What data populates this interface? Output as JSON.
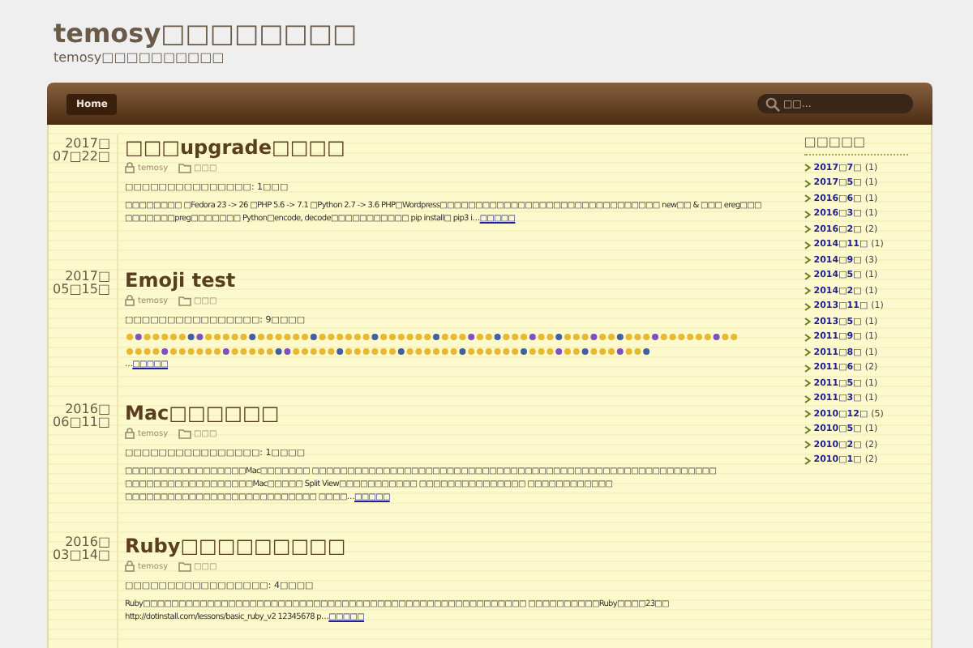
{
  "site": {
    "title": "temosy□□□□□□□□",
    "tagline": "temosy□□□□□□□□□□"
  },
  "nav": {
    "items": [
      {
        "label": "Home",
        "selected": true
      }
    ],
    "search": {
      "placeholder": "□□…"
    }
  },
  "posts": [
    {
      "date_year": "2017□",
      "date_day": "07□22□",
      "title": "□□□upgrade□□□□",
      "author": "temosy",
      "category": "□□□",
      "summary": "□□□□□□□□□□□□□□□: 1□□□",
      "kind": "text",
      "excerpt": "□□□□□□□□ □Fedora 23 -> 26 □PHP 5.6 -> 7.1 □Python 2.7 -> 3.6 PHP□Wordpress□□□□□□□□□□□□□□□□□□□□□□□□□□□□□□□ new□□ & □□□ ereg□□□ □□□□□□□preg□□□□□□□ Python□encode, decode□□□□□□□□□□□ pip install□ pip3 i…",
      "more": "□□□□□"
    },
    {
      "date_year": "2017□",
      "date_day": "05□15□",
      "title": "Emoji test",
      "author": "temosy",
      "category": "□□□",
      "summary": "□□□□□□□□□□□□□□□□: 9□□□□",
      "kind": "emoji",
      "excerpt": "…",
      "more": "□□□□□"
    },
    {
      "date_year": "2016□",
      "date_day": "06□11□",
      "title": "Mac□□□□□□",
      "author": "temosy",
      "category": "□□□",
      "summary": "□□□□□□□□□□□□□□□□: 1□□□□",
      "kind": "text",
      "excerpt": "□□□□□□□□□□□□□□□□□Mac□□□□□□□ □□□□□□□□□□□□□□□□□□□□□□□□□□□□□□□□□□□□□□□□□□□□□□□□□□□□□□□□□ □□□□□□□□□□□□□□□□□□Mac□□□□□ Split View□□□□□□□□□□□ □□□□□□□□□□□□□□□ □□□□□□□□□□□□ □□□□□□□□□□□□□□□□□□□□□□□□□□□ □□□□…",
      "more": "□□□□□"
    },
    {
      "date_year": "2016□",
      "date_day": "03□14□",
      "title": "Ruby□□□□□□□□□",
      "author": "temosy",
      "category": "□□□",
      "summary": "□□□□□□□□□□□□□□□□□: 4□□□□",
      "kind": "text",
      "excerpt": "Ruby□□□□□□□□□□□□□□□□□□□□□□□□□□□□□□□□□□□□□□□□□□□□□□□□□□□□□□ □□□□□□□□□□Ruby□□□□23□□ http://dotinstall.com/lessons/basic_ruby_v2 12345678 p…",
      "more": "□□□□□"
    }
  ],
  "sidebar": {
    "heading": "□□□□□",
    "archives": [
      {
        "label": "2017□7□",
        "count": "(1)"
      },
      {
        "label": "2017□5□",
        "count": "(1)"
      },
      {
        "label": "2016□6□",
        "count": "(1)"
      },
      {
        "label": "2016□3□",
        "count": "(1)"
      },
      {
        "label": "2016□2□",
        "count": "(2)"
      },
      {
        "label": "2014□11□",
        "count": "(1)"
      },
      {
        "label": "2014□9□",
        "count": "(3)"
      },
      {
        "label": "2014□5□",
        "count": "(1)"
      },
      {
        "label": "2014□2□",
        "count": "(1)"
      },
      {
        "label": "2013□11□",
        "count": "(1)"
      },
      {
        "label": "2013□5□",
        "count": "(1)"
      },
      {
        "label": "2011□9□",
        "count": "(1)"
      },
      {
        "label": "2011□8□",
        "count": "(1)"
      },
      {
        "label": "2011□6□",
        "count": "(2)"
      },
      {
        "label": "2011□5□",
        "count": "(1)"
      },
      {
        "label": "2011□3□",
        "count": "(1)"
      },
      {
        "label": "2010□12□",
        "count": "(5)"
      },
      {
        "label": "2010□5□",
        "count": "(1)"
      },
      {
        "label": "2010□2□",
        "count": "(2)"
      },
      {
        "label": "2010□1□",
        "count": "(2)"
      }
    ]
  }
}
